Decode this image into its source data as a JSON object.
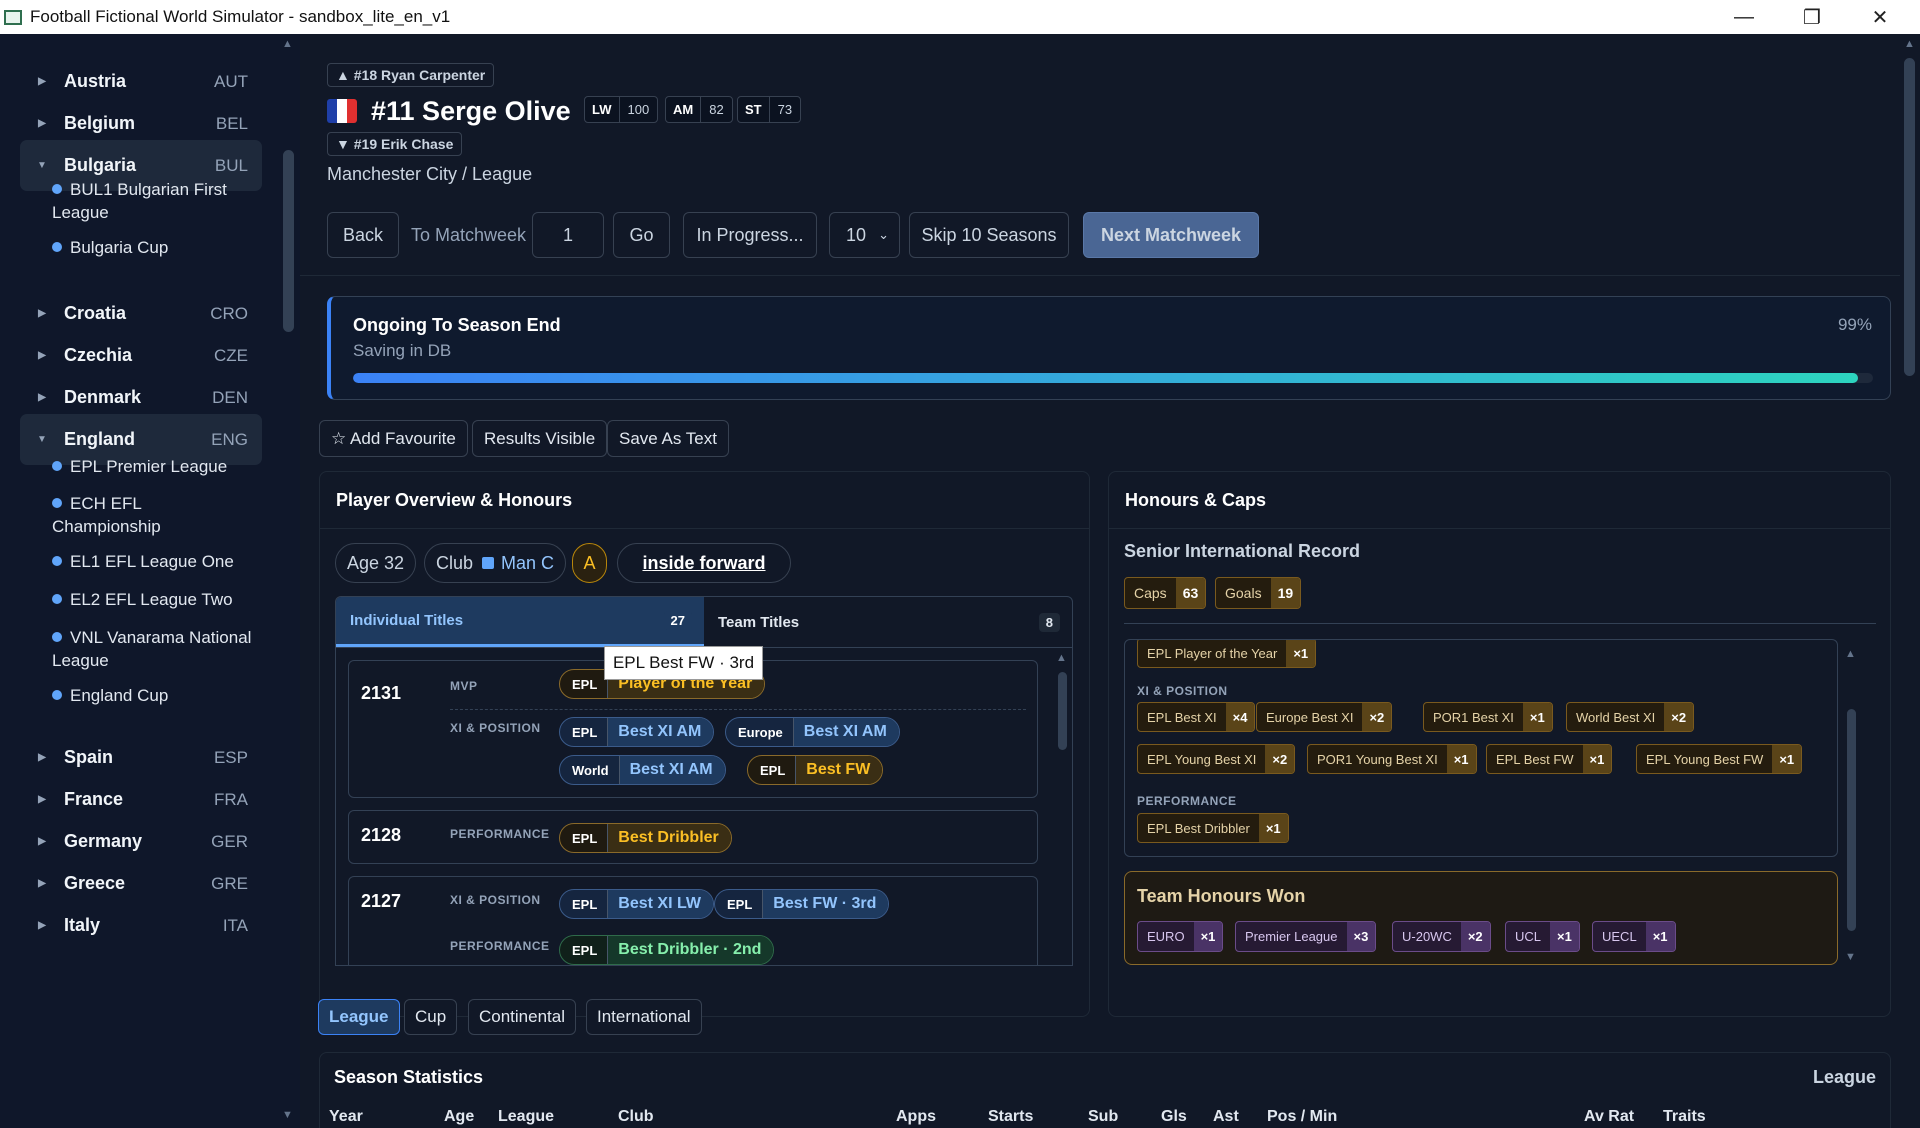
{
  "window": {
    "title": "Football Fictional World Simulator - sandbox_lite_en_v1"
  },
  "sidebar": {
    "countries": [
      {
        "name": "Austria",
        "code": "AUT",
        "expanded": false
      },
      {
        "name": "Belgium",
        "code": "BEL",
        "expanded": false
      },
      {
        "name": "Bulgaria",
        "code": "BUL",
        "expanded": true,
        "leagues": [
          "BUL1 Bulgarian First League",
          "Bulgaria Cup"
        ]
      },
      {
        "name": "Croatia",
        "code": "CRO",
        "expanded": false
      },
      {
        "name": "Czechia",
        "code": "CZE",
        "expanded": false
      },
      {
        "name": "Denmark",
        "code": "DEN",
        "expanded": false
      },
      {
        "name": "England",
        "code": "ENG",
        "expanded": true,
        "leagues": [
          "EPL Premier League",
          "ECH EFL Championship",
          "EL1 EFL League One",
          "EL2 EFL League Two",
          "VNL Vanarama National League",
          "England Cup"
        ]
      },
      {
        "name": "Spain",
        "code": "ESP",
        "expanded": false
      },
      {
        "name": "France",
        "code": "FRA",
        "expanded": false
      },
      {
        "name": "Germany",
        "code": "GER",
        "expanded": false
      },
      {
        "name": "Greece",
        "code": "GRE",
        "expanded": false
      },
      {
        "name": "Italy",
        "code": "ITA",
        "expanded": false
      }
    ]
  },
  "player": {
    "prev": "▲ #18 Ryan Carpenter",
    "next": "▼ #19 Erik Chase",
    "name": "#11 Serge Olive",
    "positions": [
      {
        "pos": "LW",
        "rating": "100"
      },
      {
        "pos": "AM",
        "rating": "82"
      },
      {
        "pos": "ST",
        "rating": "73"
      }
    ],
    "club_line": "Manchester City / League",
    "flag_colors": [
      "#1f3fa8",
      "#ffffff",
      "#e03030"
    ]
  },
  "controls": {
    "back": "Back",
    "to_matchweek": "To Matchweek",
    "matchweek_value": "1",
    "go": "Go",
    "in_progress": "In Progress...",
    "seasons_select": "10",
    "skip": "Skip 10 Seasons",
    "next": "Next Matchweek"
  },
  "progress": {
    "title": "Ongoing To Season End",
    "status": "Saving in DB",
    "percent_label": "99%",
    "fraction": 0.99
  },
  "actions": {
    "favourite": "☆ Add Favourite",
    "results": "Results Visible",
    "save": "Save As Text"
  },
  "overview": {
    "title": "Player Overview & Honours",
    "age": "Age 32",
    "club_label": "Club",
    "club_name": "Man C",
    "grade": "A",
    "role": "inside forward",
    "tabs": [
      {
        "label": "Individual Titles",
        "count": "27"
      },
      {
        "label": "Team Titles",
        "count": "8"
      }
    ],
    "years": [
      {
        "year": "2131",
        "rows": [
          {
            "cat": "MVP",
            "awards": [
              {
                "c": "EPL",
                "t": "Player of the Year",
                "tone": "gold"
              }
            ]
          },
          {
            "cat": "XI & POSITION",
            "awards": [
              {
                "c": "EPL",
                "t": "Best XI  AM",
                "tone": "blue"
              },
              {
                "c": "Europe",
                "t": "Best XI  AM",
                "tone": "blue"
              },
              {
                "c": "World",
                "t": "Best XI  AM",
                "tone": "blue"
              },
              {
                "c": "EPL",
                "t": "Best FW",
                "tone": "gold"
              }
            ]
          }
        ]
      },
      {
        "year": "2128",
        "rows": [
          {
            "cat": "PERFORMANCE",
            "awards": [
              {
                "c": "EPL",
                "t": "Best Dribbler",
                "tone": "gold"
              }
            ]
          }
        ]
      },
      {
        "year": "2127",
        "rows": [
          {
            "cat": "XI & POSITION",
            "awards": [
              {
                "c": "EPL",
                "t": "Best XI  LW",
                "tone": "blue"
              },
              {
                "c": "EPL",
                "t": "Best FW · 3rd",
                "tone": "blue"
              }
            ]
          },
          {
            "cat": "PERFORMANCE",
            "awards": [
              {
                "c": "EPL",
                "t": "Best Dribbler · 2nd",
                "tone": "green"
              }
            ]
          }
        ]
      }
    ],
    "tooltip": "EPL Best FW · 3rd"
  },
  "honours": {
    "title": "Honours & Caps",
    "intl_title": "Senior International Record",
    "caps_label": "Caps",
    "caps": "63",
    "goals_label": "Goals",
    "goals": "19",
    "top_badge": {
      "l": "EPL Player of the Year",
      "v": "×1"
    },
    "xi_label": "XI & POSITION",
    "xi": [
      {
        "l": "EPL Best XI",
        "v": "×4"
      },
      {
        "l": "Europe Best XI",
        "v": "×2"
      },
      {
        "l": "POR1 Best XI",
        "v": "×1"
      },
      {
        "l": "World Best XI",
        "v": "×2"
      },
      {
        "l": "EPL Young Best XI",
        "v": "×2"
      },
      {
        "l": "POR1 Young Best XI",
        "v": "×1"
      },
      {
        "l": "EPL Best FW",
        "v": "×1"
      },
      {
        "l": "EPL Young Best FW",
        "v": "×1"
      }
    ],
    "perf_label": "PERFORMANCE",
    "perf": [
      {
        "l": "EPL Best Dribbler",
        "v": "×1"
      }
    ],
    "team_title": "Team Honours Won",
    "team": [
      {
        "l": "EURO",
        "v": "×1"
      },
      {
        "l": "Premier League",
        "v": "×3"
      },
      {
        "l": "U-20WC",
        "v": "×2"
      },
      {
        "l": "UCL",
        "v": "×1"
      },
      {
        "l": "UECL",
        "v": "×1"
      }
    ]
  },
  "filters": [
    "League",
    "Cup",
    "Continental",
    "International"
  ],
  "season_stats": {
    "title": "Season Statistics",
    "scope": "League",
    "headers": [
      "Year",
      "Age",
      "League",
      "Club",
      "Apps",
      "Starts",
      "Sub",
      "Gls",
      "Ast",
      "Pos / Min",
      "Av Rat",
      "Traits"
    ]
  }
}
